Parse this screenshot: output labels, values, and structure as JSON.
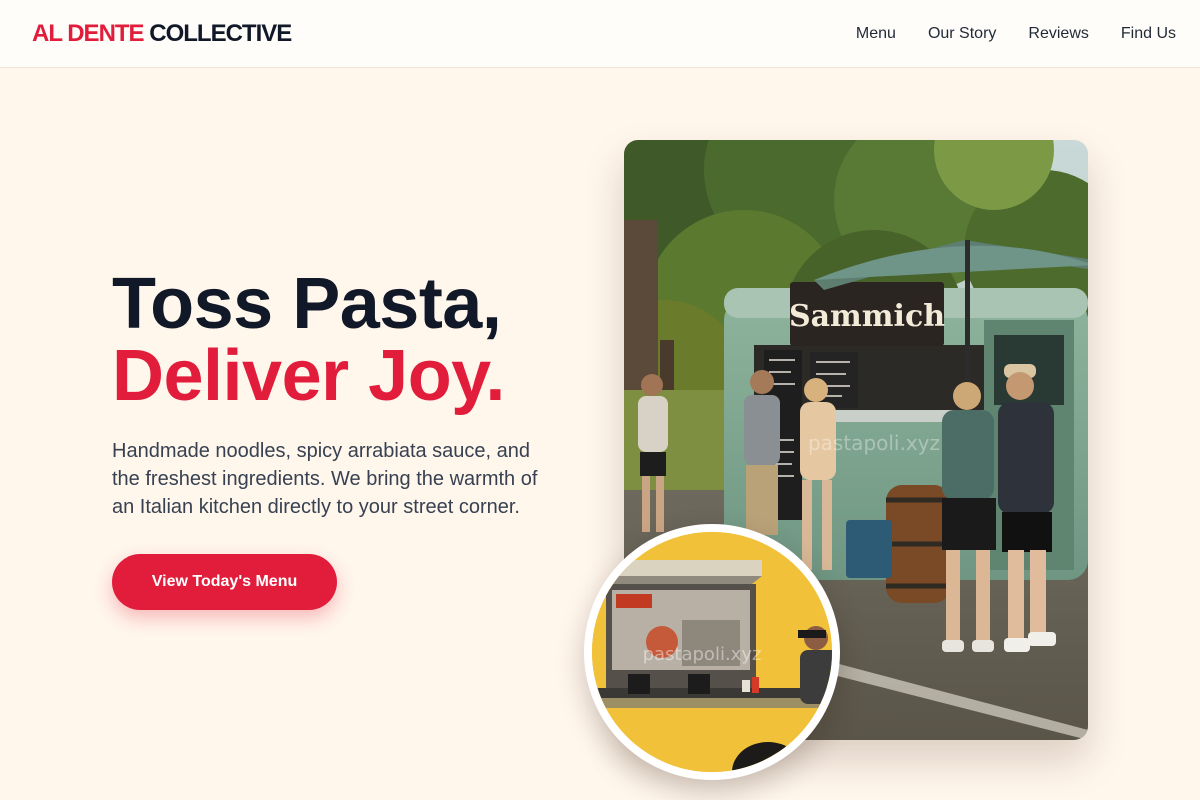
{
  "header": {
    "logo_part1": "AL DENTE",
    "logo_part2": "COLLECTIVE",
    "nav": [
      {
        "label": "Menu"
      },
      {
        "label": "Our Story"
      },
      {
        "label": "Reviews"
      },
      {
        "label": "Find Us"
      }
    ]
  },
  "hero": {
    "title_line1": "Toss Pasta,",
    "title_line2": "Deliver Joy.",
    "description": "Handmade noodles, spicy arrabiata sauce, and the freshest ingredients. We bring the warmth of an Italian kitchen directly to your street corner.",
    "cta_label": "View Today's Menu"
  },
  "images": {
    "main_sign_text": "Sammich",
    "main_watermark": "pastapoli.xyz",
    "inset_watermark": "pastapoli.xyz"
  },
  "colors": {
    "accent": "#e11d3b",
    "dark": "#111827",
    "background": "#fff6ec",
    "truck_green": "#7fa58f",
    "inset_yellow": "#f2c13a"
  }
}
